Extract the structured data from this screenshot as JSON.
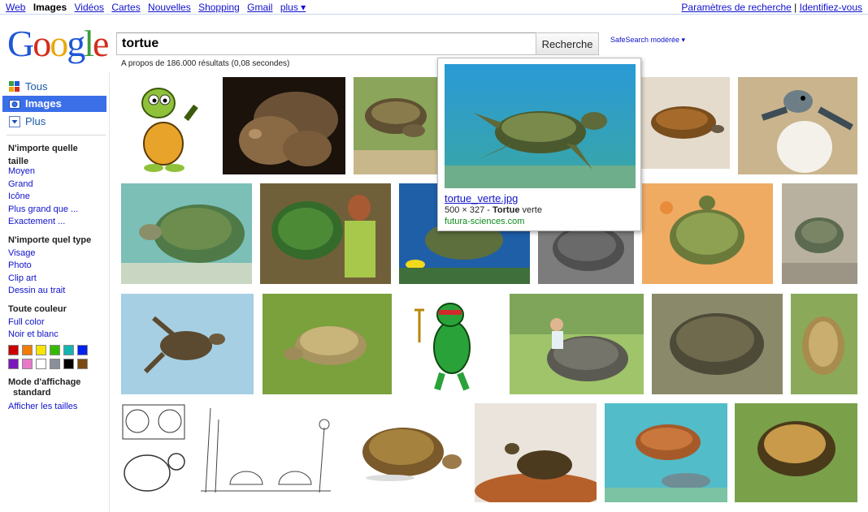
{
  "topnav": {
    "items": [
      "Web",
      "Images",
      "Vidéos",
      "Cartes",
      "Nouvelles",
      "Shopping",
      "Gmail",
      "plus ▾"
    ],
    "active_index": 1,
    "settings_link": "Paramètres de recherche",
    "separator": "|",
    "signin_link": "Identifiez-vous"
  },
  "logo": {
    "text": "Google"
  },
  "search": {
    "query": "tortue",
    "button_label": "Recherche",
    "safesearch": "SafeSearch modérée ▾",
    "results_count": "A propos de 186.000 résultats (0,08 secondes)"
  },
  "sidebar": {
    "nav": [
      {
        "label": "Tous",
        "icon": "google-tous-icon",
        "selected": false
      },
      {
        "label": "Images",
        "icon": "camera-icon",
        "selected": true
      },
      {
        "label": "Plus",
        "icon": "chevron-down-icon",
        "selected": false
      }
    ],
    "size_heading": "N'importe quelle taille",
    "size_heading_l1": "N'importe quelle",
    "size_heading_l2": "taille",
    "size_options": [
      "Moyen",
      "Grand",
      "Icône",
      "Plus grand que ...",
      "Exactement ..."
    ],
    "type_heading": "N'importe quel type",
    "type_options": [
      "Visage",
      "Photo",
      "Clip art",
      "Dessin au trait"
    ],
    "color_heading": "Toute couleur",
    "color_options": [
      "Full color",
      "Noir et blanc"
    ],
    "swatches": [
      "#cc0000",
      "#f07d00",
      "#f5e500",
      "#33bb00",
      "#12b5b0",
      "#0022ee",
      "#7a18b9",
      "#e779c8",
      "#ffffff",
      "#8a8f99",
      "#000000",
      "#7a4a12"
    ],
    "display_heading_l1": "Mode d'affichage",
    "display_heading_l2": "standard",
    "display_option": "Afficher les tailles"
  },
  "popup": {
    "filename": "tortue_verte.jpg",
    "dims_prefix": "500 × 327 - ",
    "dims_bold": "Tortue",
    "dims_suffix": " verte",
    "site": "futura-sciences.com"
  }
}
